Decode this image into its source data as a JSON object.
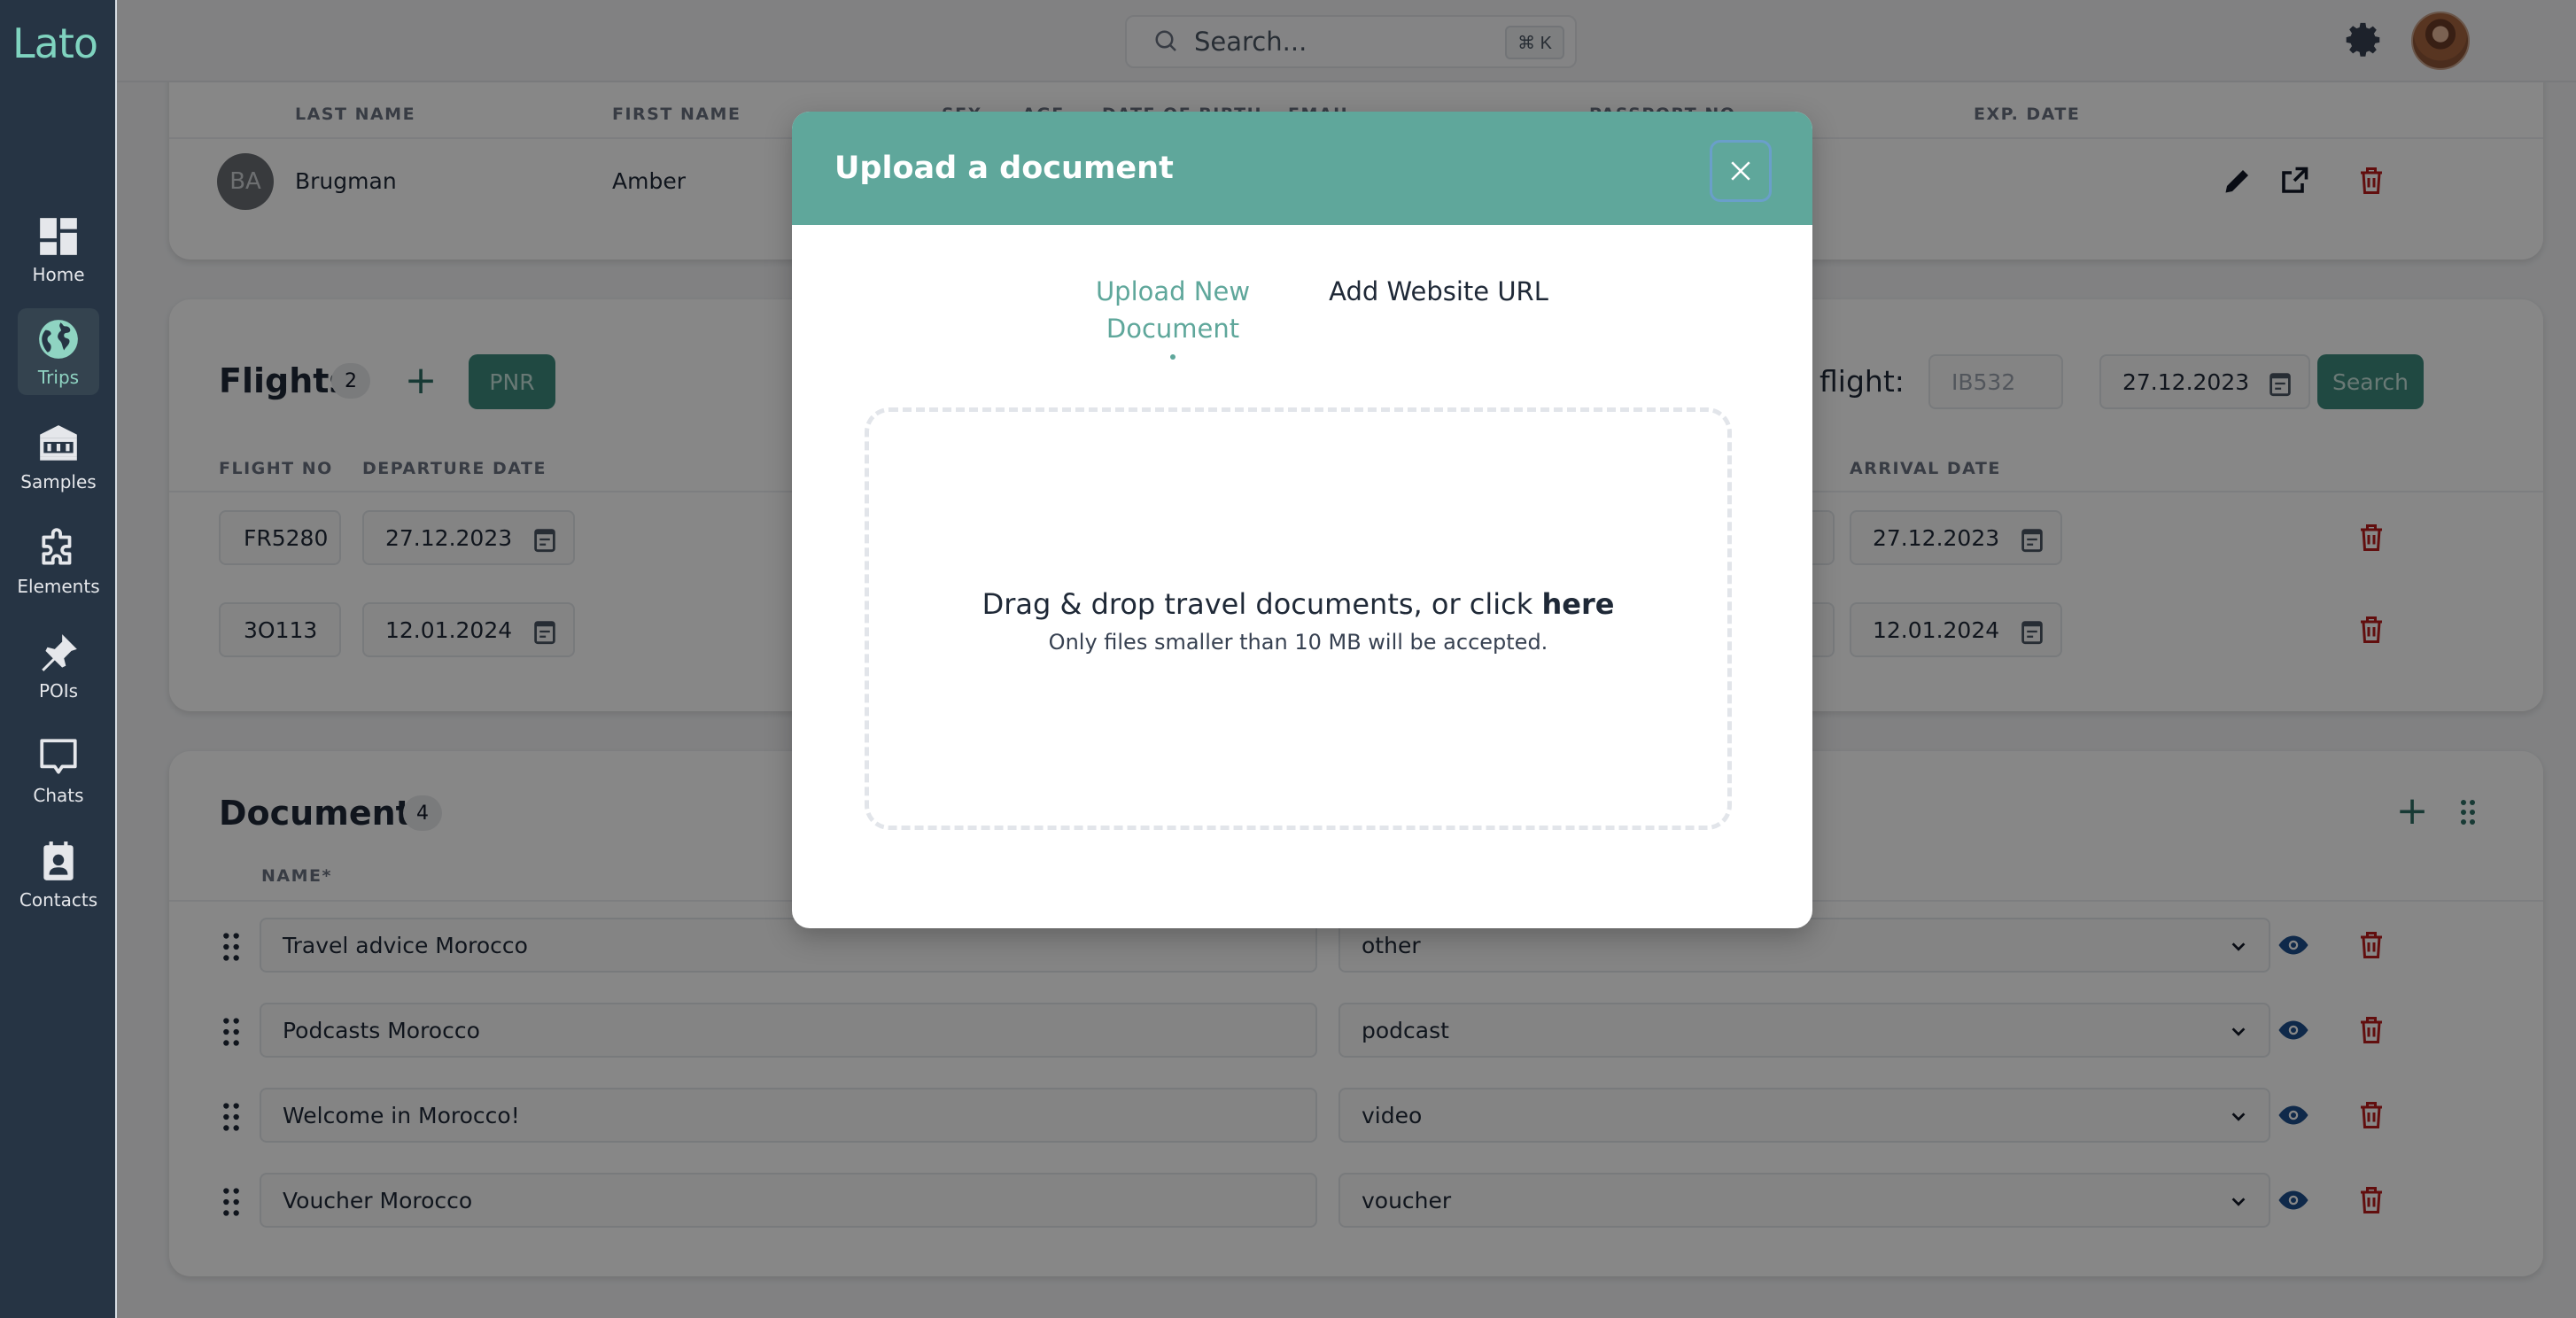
{
  "app": {
    "logo": "Lato"
  },
  "sidebar": {
    "items": [
      {
        "label": "Home",
        "icon": "dashboard-icon",
        "active": false
      },
      {
        "label": "Trips",
        "icon": "globe-icon",
        "active": true
      },
      {
        "label": "Samples",
        "icon": "bank-icon",
        "active": false
      },
      {
        "label": "Elements",
        "icon": "puzzle-icon",
        "active": false
      },
      {
        "label": "POIs",
        "icon": "pin-icon",
        "active": false
      },
      {
        "label": "Chats",
        "icon": "chat-icon",
        "active": false
      },
      {
        "label": "Contacts",
        "icon": "contact-card-icon",
        "active": false
      }
    ]
  },
  "header": {
    "search_placeholder": "Search...",
    "search_shortcut": "⌘ K"
  },
  "travelers": {
    "columns": [
      "LAST NAME",
      "FIRST NAME",
      "SEX",
      "AGE",
      "DATE OF BIRTH",
      "EMAIL",
      "PASSPORT NO",
      "EXP. DATE"
    ],
    "rows": [
      {
        "initials": "BA",
        "last_name": "Brugman",
        "first_name": "Amber"
      }
    ]
  },
  "flights": {
    "title": "Flights",
    "count": "2",
    "pnr_label": "PNR",
    "search_label": "flight:",
    "search_flight_placeholder": "IB532",
    "search_date": "27.12.2023",
    "search_button": "Search",
    "columns": [
      "FLIGHT NO",
      "DEPARTURE DATE",
      "ARRIVAL DATE"
    ],
    "rows": [
      {
        "flight_no": "FR5280",
        "departure_date": "27.12.2023",
        "arrival_date": "27.12.2023"
      },
      {
        "flight_no": "3O113",
        "departure_date": "12.01.2024",
        "arrival_date": "12.01.2024"
      }
    ]
  },
  "documents": {
    "title": "Documents",
    "count": "4",
    "columns": [
      "NAME*"
    ],
    "rows": [
      {
        "name": "Travel advice Morocco",
        "type": "other"
      },
      {
        "name": "Podcasts Morocco",
        "type": "podcast"
      },
      {
        "name": "Welcome in Morocco!",
        "type": "video"
      },
      {
        "name": "Voucher Morocco",
        "type": "voucher"
      }
    ]
  },
  "modal": {
    "title": "Upload a document",
    "tabs": [
      {
        "label": "Upload New Document",
        "active": true
      },
      {
        "label": "Add Website URL",
        "active": false
      }
    ],
    "dropzone_text": "Drag & drop travel documents, or click ",
    "dropzone_link": "here",
    "dropzone_subtext": "Only files smaller than 10 MB will be accepted."
  },
  "colors": {
    "brand": "#5fa79b",
    "sidebar_bg": "#263444",
    "danger": "#b91c1c",
    "view_icon": "#1e4e8c"
  }
}
